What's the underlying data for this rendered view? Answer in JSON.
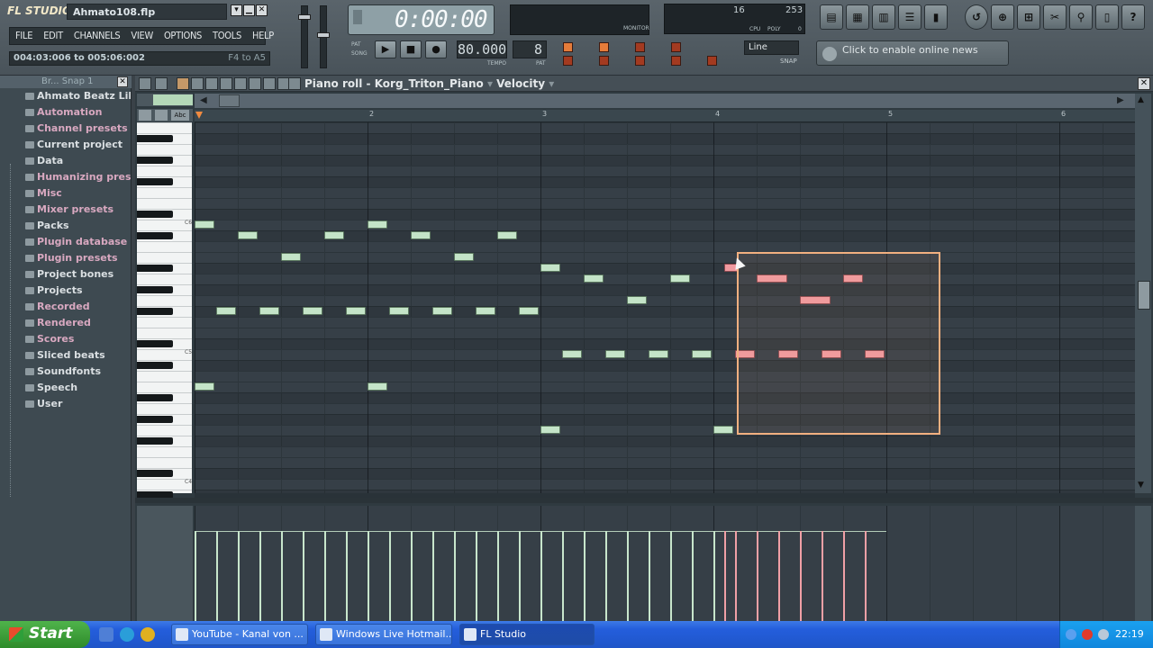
{
  "app": {
    "logo": "FL STUDIO",
    "project_file": "Ahmato108.flp",
    "menu": [
      "FILE",
      "EDIT",
      "CHANNELS",
      "VIEW",
      "OPTIONS",
      "TOOLS",
      "HELP"
    ],
    "hint_left": "004:03:006 to 005:06:002",
    "hint_right": "F4 to A5"
  },
  "transport": {
    "time": "0:00:00",
    "tempo": "80.000",
    "pattern": "8",
    "tempo_label": "TEMPO",
    "pat_label": "PAT",
    "mode_pat": "PAT",
    "mode_song": "SONG",
    "monitor_label": "MONITOR"
  },
  "cpu": {
    "value1": "16",
    "value2": "253",
    "cpu_label": "CPU",
    "poly_label": "POLY",
    "poly_value": "0"
  },
  "snap": {
    "mode": "Line",
    "label": "SNAP"
  },
  "news": {
    "text": "Click to enable online news"
  },
  "browser": {
    "header": "Br... Snap 1",
    "items": [
      {
        "label": "Ahmato Beatz Liba",
        "pink": false
      },
      {
        "label": "Automation",
        "pink": true
      },
      {
        "label": "Channel presets",
        "pink": true
      },
      {
        "label": "Current project",
        "pink": false
      },
      {
        "label": "Data",
        "pink": false
      },
      {
        "label": "Humanizing preset",
        "pink": true
      },
      {
        "label": "Misc",
        "pink": true
      },
      {
        "label": "Mixer presets",
        "pink": true
      },
      {
        "label": "Packs",
        "pink": false
      },
      {
        "label": "Plugin database",
        "pink": true
      },
      {
        "label": "Plugin presets",
        "pink": true
      },
      {
        "label": "Project bones",
        "pink": false
      },
      {
        "label": "Projects",
        "pink": false
      },
      {
        "label": "Recorded",
        "pink": true
      },
      {
        "label": "Rendered",
        "pink": true
      },
      {
        "label": "Scores",
        "pink": true
      },
      {
        "label": "Sliced beats",
        "pink": false
      },
      {
        "label": "Soundfonts",
        "pink": false
      },
      {
        "label": "Speech",
        "pink": false
      },
      {
        "label": "User",
        "pink": false
      }
    ]
  },
  "piano_roll": {
    "title": "Piano roll - Korg_Triton_Piano",
    "target": "Velocity",
    "bars": [
      "2",
      "3",
      "4",
      "5",
      "6"
    ],
    "key_labels": [
      "C6",
      "C5",
      "C4"
    ],
    "notes": [
      {
        "bar": 1.0,
        "len": 0.125,
        "row": 9,
        "sel": false
      },
      {
        "bar": 1.125,
        "len": 0.125,
        "row": 17,
        "sel": false
      },
      {
        "bar": 1.25,
        "len": 0.125,
        "row": 10,
        "sel": false
      },
      {
        "bar": 1.375,
        "len": 0.125,
        "row": 17,
        "sel": false
      },
      {
        "bar": 1.5,
        "len": 0.125,
        "row": 12,
        "sel": false
      },
      {
        "bar": 1.625,
        "len": 0.125,
        "row": 17,
        "sel": false
      },
      {
        "bar": 1.75,
        "len": 0.125,
        "row": 10,
        "sel": false
      },
      {
        "bar": 1.875,
        "len": 0.125,
        "row": 17,
        "sel": false
      },
      {
        "bar": 2.0,
        "len": 0.125,
        "row": 9,
        "sel": false
      },
      {
        "bar": 2.0,
        "len": 0.125,
        "row": 24,
        "sel": false
      },
      {
        "bar": 1.0,
        "len": 0.125,
        "row": 24,
        "sel": false
      },
      {
        "bar": 2.125,
        "len": 0.125,
        "row": 17,
        "sel": false
      },
      {
        "bar": 2.25,
        "len": 0.125,
        "row": 10,
        "sel": false
      },
      {
        "bar": 2.375,
        "len": 0.125,
        "row": 17,
        "sel": false
      },
      {
        "bar": 2.5,
        "len": 0.125,
        "row": 12,
        "sel": false
      },
      {
        "bar": 2.625,
        "len": 0.125,
        "row": 17,
        "sel": false
      },
      {
        "bar": 2.75,
        "len": 0.125,
        "row": 10,
        "sel": false
      },
      {
        "bar": 2.875,
        "len": 0.125,
        "row": 17,
        "sel": false
      },
      {
        "bar": 3.0,
        "len": 0.125,
        "row": 13,
        "sel": false
      },
      {
        "bar": 3.0,
        "len": 0.125,
        "row": 28,
        "sel": false
      },
      {
        "bar": 3.125,
        "len": 0.125,
        "row": 21,
        "sel": false
      },
      {
        "bar": 3.25,
        "len": 0.125,
        "row": 14,
        "sel": false
      },
      {
        "bar": 3.375,
        "len": 0.125,
        "row": 21,
        "sel": false
      },
      {
        "bar": 3.5,
        "len": 0.125,
        "row": 16,
        "sel": false
      },
      {
        "bar": 3.625,
        "len": 0.125,
        "row": 21,
        "sel": false
      },
      {
        "bar": 3.75,
        "len": 0.125,
        "row": 14,
        "sel": false
      },
      {
        "bar": 3.875,
        "len": 0.125,
        "row": 21,
        "sel": false
      },
      {
        "bar": 4.0,
        "len": 0.125,
        "row": 28,
        "sel": false
      },
      {
        "bar": 4.06,
        "len": 0.09,
        "row": 13,
        "sel": true
      },
      {
        "bar": 4.125,
        "len": 0.125,
        "row": 21,
        "sel": true
      },
      {
        "bar": 4.25,
        "len": 0.19,
        "row": 14,
        "sel": true
      },
      {
        "bar": 4.375,
        "len": 0.125,
        "row": 21,
        "sel": true
      },
      {
        "bar": 4.5,
        "len": 0.19,
        "row": 16,
        "sel": true
      },
      {
        "bar": 4.625,
        "len": 0.125,
        "row": 21,
        "sel": true
      },
      {
        "bar": 4.75,
        "len": 0.125,
        "row": 14,
        "sel": true
      },
      {
        "bar": 4.875,
        "len": 0.125,
        "row": 21,
        "sel": true
      }
    ]
  },
  "taskbar": {
    "start": "Start",
    "tasks": [
      {
        "label": "YouTube - Kanal von ...",
        "active": false
      },
      {
        "label": "Windows Live Hotmail...",
        "active": false
      },
      {
        "label": "FL Studio",
        "active": true
      }
    ],
    "clock": "22:19"
  },
  "colors": {
    "note_default": "#c4e4c8",
    "note_selected": "#f09aa0",
    "selection_rect": "#f2b080"
  }
}
